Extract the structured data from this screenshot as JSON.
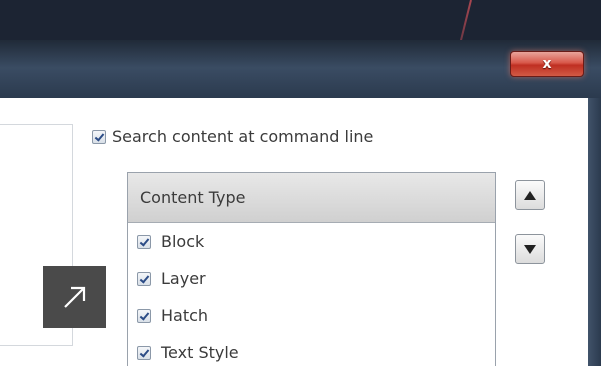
{
  "window": {
    "close_label": "x"
  },
  "search_option": {
    "label": "Search content at command line",
    "checked": true
  },
  "content_list": {
    "header": "Content Type",
    "items": [
      {
        "label": "Block",
        "checked": true
      },
      {
        "label": "Layer",
        "checked": true
      },
      {
        "label": "Hatch",
        "checked": true
      },
      {
        "label": "Text Style",
        "checked": true
      }
    ]
  },
  "icons": {
    "move_up": "triangle-up-icon",
    "move_down": "triangle-down-icon",
    "expand": "arrow-up-right-icon"
  },
  "colors": {
    "titlebar": "#2b3a4e",
    "close_button": "#d04a3c",
    "checkmark": "#2c4c86",
    "expand_tile": "#4a4a4a"
  }
}
